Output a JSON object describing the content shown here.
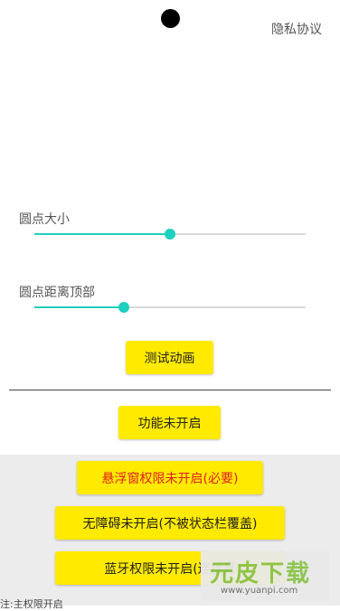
{
  "header": {
    "privacy_label": "隐私协议"
  },
  "sliders": [
    {
      "label": "圆点大小",
      "value_fraction": 0.5
    },
    {
      "label": "圆点距离顶部",
      "value_fraction": 0.33
    }
  ],
  "buttons": {
    "test_animation": "测试动画",
    "feature_status": "功能未开启",
    "float_permission": "悬浮窗权限未开启(必要)",
    "accessibility": "无障碍未开启(不被状态栏覆盖)",
    "bluetooth": "蓝牙权限未开启(连接耳"
  },
  "footer_cut_text": "注:主权限开启",
  "watermark": {
    "text": "元皮下载",
    "url": "www.yuanpi.com"
  },
  "colors": {
    "accent": "#1fcfbf",
    "button": "#ffea00",
    "warning_text": "#e02020"
  }
}
